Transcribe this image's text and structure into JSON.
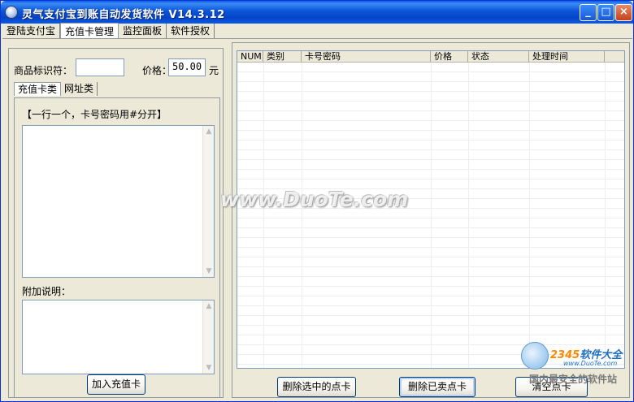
{
  "window": {
    "title": "灵气支付宝到账自动发货软件 V14.3.12",
    "minimize_glyph": "_",
    "maximize_glyph": "□",
    "close_glyph": "×"
  },
  "main_tabs": [
    {
      "label": "登陆支付宝"
    },
    {
      "label": "充值卡管理"
    },
    {
      "label": "监控面板"
    },
    {
      "label": "软件授权"
    }
  ],
  "left_panel": {
    "product_id_label": "商品标识符：",
    "product_id_value": "",
    "price_label": "价格：",
    "price_value": "50.00",
    "price_unit": "元",
    "sub_tabs": [
      {
        "label": "充值卡类"
      },
      {
        "label": "网址类"
      }
    ],
    "instruction": "【一行一个，卡号密码用#分开】",
    "extra_note_label": "附加说明：",
    "add_button": "加入充值卡"
  },
  "card_table": {
    "columns": [
      "NUM",
      "类别",
      "卡号密码",
      "价格",
      "状态",
      "处理时间"
    ],
    "rows": []
  },
  "actions": {
    "delete_selected": "删除选中的点卡",
    "delete_sold": "删除已卖点卡",
    "clear_cards": "清空点卡"
  },
  "watermark": {
    "text": "www.DuoTe.com",
    "brand_prefix": "2345",
    "brand_suffix": "软件大全",
    "brand_url": "www.DuoTe.com",
    "slogan": "国内最安全的软件站"
  }
}
